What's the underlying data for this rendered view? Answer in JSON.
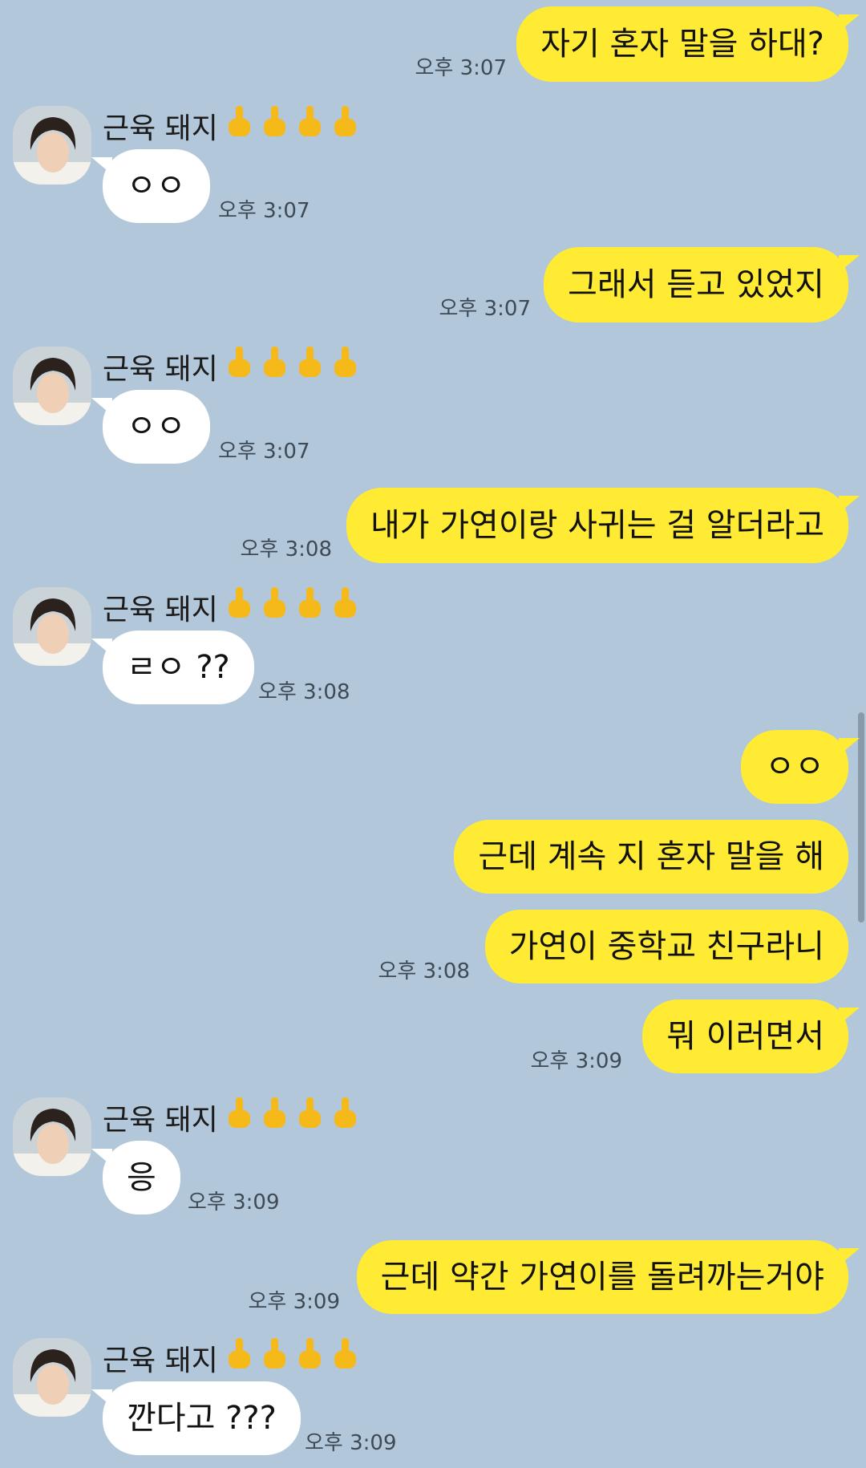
{
  "contact": {
    "name": "근육 돼지"
  },
  "messages": [
    {
      "dir": "sent",
      "text": "자기 혼자 말을 하대?",
      "time": "오후 3:07"
    },
    {
      "dir": "recv",
      "text": "ㅇㅇ",
      "time": "오후 3:07"
    },
    {
      "dir": "sent",
      "text": "그래서 듣고 있었지",
      "time": "오후 3:07"
    },
    {
      "dir": "recv",
      "text": "ㅇㅇ",
      "time": "오후 3:07"
    },
    {
      "dir": "sent",
      "text": "내가 가연이랑 사귀는 걸 알더라고",
      "time": "오후 3:08"
    },
    {
      "dir": "recv",
      "text": "ㄹㅇ ??",
      "time": "오후 3:08"
    },
    {
      "dir": "sent",
      "text": "ㅇㅇ",
      "time": ""
    },
    {
      "dir": "sent",
      "text": "근데 계속 지 혼자 말을 해",
      "time": ""
    },
    {
      "dir": "sent",
      "text": "가연이 중학교 친구라니",
      "time": "오후 3:08"
    },
    {
      "dir": "sent",
      "text": "뭐 이러면서",
      "time": "오후 3:09"
    },
    {
      "dir": "recv",
      "text": "응",
      "time": "오후 3:09"
    },
    {
      "dir": "sent",
      "text": "근데 약간 가연이를 돌려까는거야",
      "time": "오후 3:09"
    },
    {
      "dir": "recv",
      "text": "깐다고 ???",
      "time": "오후 3:09"
    }
  ],
  "colors": {
    "background": "#b2c7da",
    "sent_bubble": "#ffeb33",
    "recv_bubble": "#ffffff"
  },
  "icons": {
    "name_emoji": "middle-finger-icon"
  }
}
